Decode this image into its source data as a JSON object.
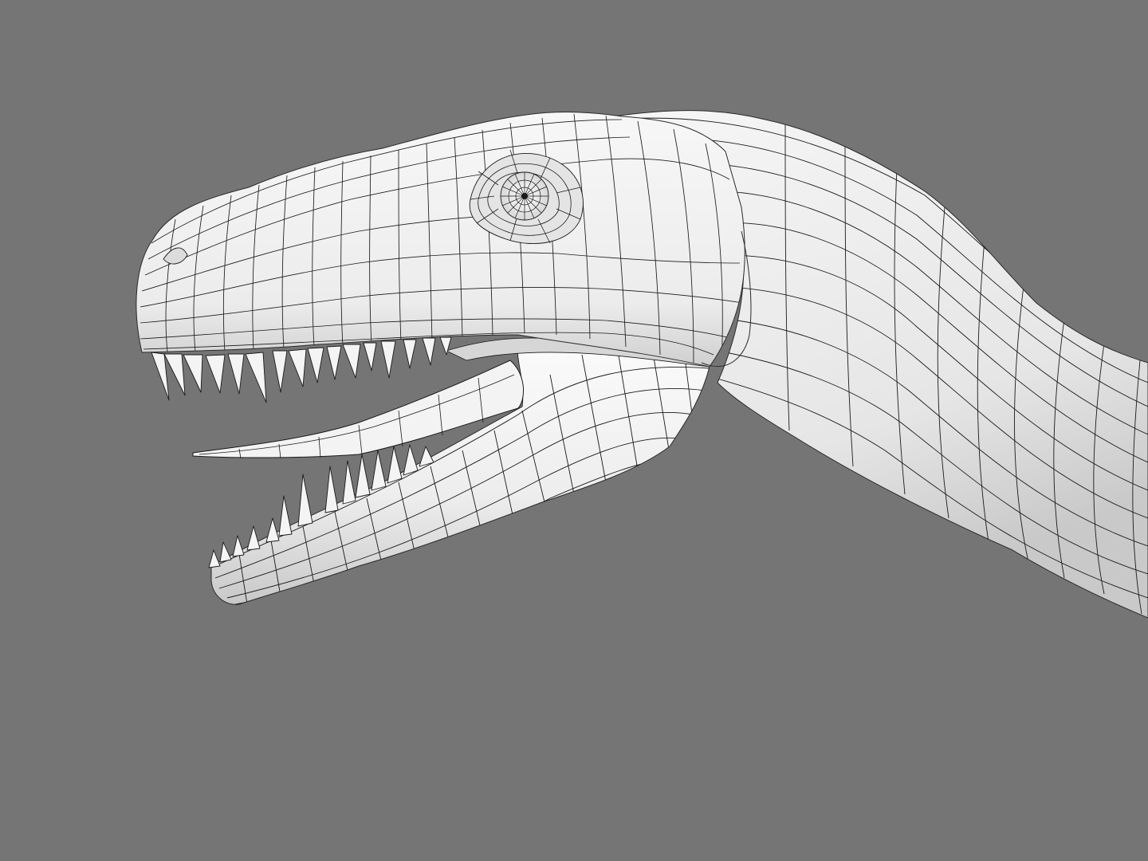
{
  "scene": {
    "background_color": "#757575",
    "mesh_fill_color": "#f2f2f2",
    "mesh_shadow_color": "#c4c4c4",
    "wire_color": "#1a1a1a",
    "subject": "dinosaur-head-wireframe",
    "render_mode": "shaded-with-wireframe"
  }
}
